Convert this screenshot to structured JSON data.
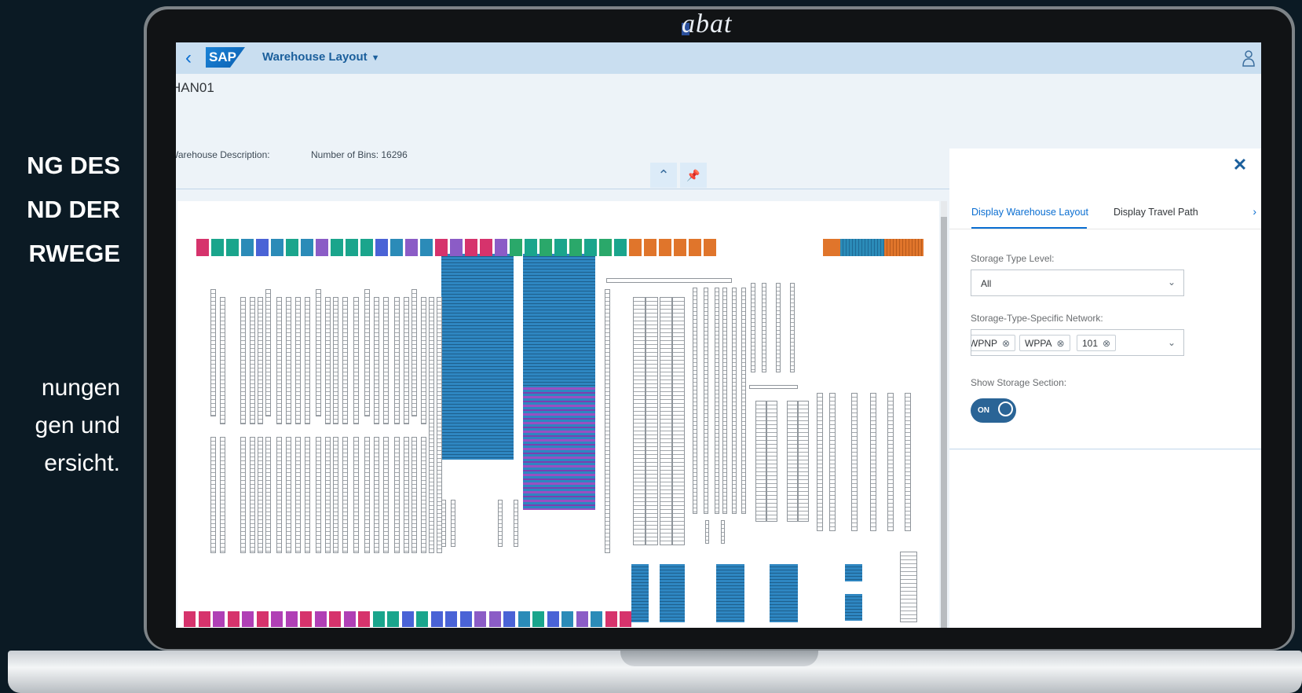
{
  "promo": {
    "heading_lines": [
      "NG DES",
      "ND DER",
      "RWEGE"
    ],
    "body_lines": [
      "nungen",
      "gen und",
      "ersicht."
    ]
  },
  "brand": "abat",
  "shellbar": {
    "logo": "SAP",
    "app_title": "Warehouse Layout",
    "icons": [
      "back-icon",
      "user-icon",
      "caret-down-icon"
    ]
  },
  "header": {
    "title": "HAN01",
    "description_label": "Warehouse Description:",
    "bins_text": "Number of Bins: 16296",
    "collapse_glyph": "⌃",
    "pin_glyph": "📌"
  },
  "panel": {
    "close_glyph": "✕",
    "tabs": [
      "Display Warehouse Layout",
      "Display Travel Path"
    ],
    "active_tab": "Display Warehouse Layout",
    "storage_type_level": {
      "label": "Storage Type Level:",
      "value": "All"
    },
    "network": {
      "label": "Storage-Type-Specific Network:",
      "tokens": [
        "WPNP",
        "WPPA",
        "101"
      ]
    },
    "storage_section": {
      "label": "Show Storage Section:",
      "state": "ON"
    }
  },
  "colors": {
    "bin_palette": [
      "#d6336c",
      "#1aa58c",
      "#2b8bb8",
      "#4a63d6",
      "#8b5cc6",
      "#e0752b",
      "#b03fb5",
      "#2aa86a"
    ],
    "shellbar": "#c9def0",
    "accent": "#0a6ed1",
    "switch": "#2a6496"
  }
}
